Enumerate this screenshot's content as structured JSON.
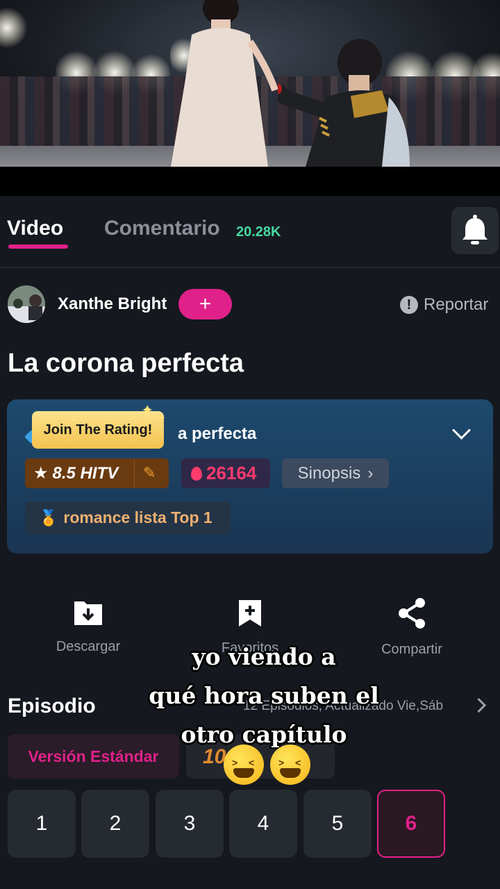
{
  "tabs": {
    "video": "Video",
    "comments": "Comentario",
    "comments_count": "20.28K"
  },
  "author": {
    "name": "Xanthe Bright",
    "follow": "+",
    "report": "Reportar"
  },
  "title": "La corona perfecta",
  "info_card": {
    "tooltip": "Join The Rating!",
    "title_visible": "a perfecta",
    "rating": "8.5 HITV",
    "heat": "26164",
    "synopsis": "Sinopsis",
    "rank": "romance lista Top 1"
  },
  "actions": {
    "download": "Descargar",
    "favorites": "Favoritos",
    "share": "Compartir"
  },
  "episodes": {
    "title": "Episodio",
    "info": "12 Episodios, Actualizado Vie,Sáb",
    "version_standard": "Versión Estándar",
    "version_other": "10",
    "list": [
      "1",
      "2",
      "3",
      "4",
      "5",
      "6"
    ],
    "selected": "6"
  },
  "caption": {
    "line1": "yo viendo a",
    "line2": "qué hora suben el",
    "line3": "otro capítulo"
  },
  "colors": {
    "accent": "#e0218a",
    "count_green": "#47d7a0",
    "heat_red": "#ff3b6e",
    "background": "#15181e"
  }
}
